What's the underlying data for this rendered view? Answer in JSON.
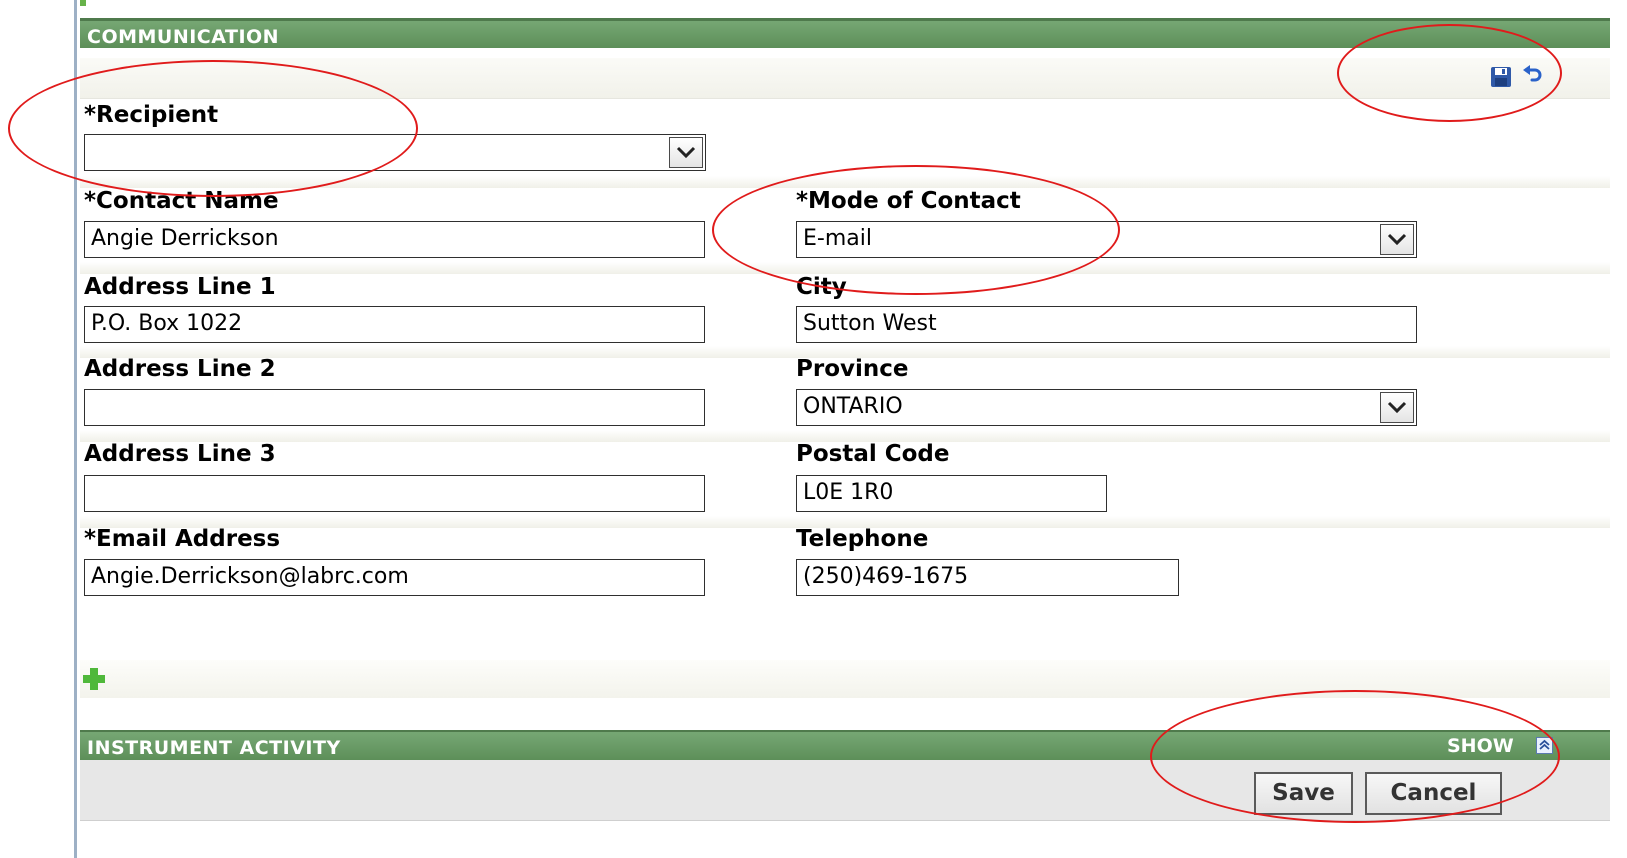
{
  "communication": {
    "title": "COMMUNICATION",
    "toolbar_icons": [
      "save-icon",
      "undo-icon"
    ]
  },
  "form": {
    "recipient": {
      "label": "*Recipient",
      "value": ""
    },
    "contact_name": {
      "label": "*Contact Name",
      "value": "Angie Derrickson"
    },
    "mode_of_contact": {
      "label": "*Mode of Contact",
      "value": "E-mail"
    },
    "address_line_1": {
      "label": "Address Line 1",
      "value": "P.O. Box 1022"
    },
    "city": {
      "label": "City",
      "value": "Sutton West"
    },
    "address_line_2": {
      "label": "Address Line 2",
      "value": ""
    },
    "province": {
      "label": "Province",
      "value": "ONTARIO"
    },
    "address_line_3": {
      "label": "Address Line 3",
      "value": ""
    },
    "postal_code": {
      "label": "Postal Code",
      "value": "L0E 1R0"
    },
    "email_address": {
      "label": "*Email Address",
      "value": "Angie.Derrickson@labrc.com"
    },
    "telephone": {
      "label": "Telephone",
      "value": "(250)469-1675"
    }
  },
  "instrument_activity": {
    "title": "INSTRUMENT ACTIVITY",
    "toggle_label": "SHOW"
  },
  "buttons": {
    "save": "Save",
    "cancel": "Cancel"
  },
  "colors": {
    "section_header": "#6a9b66",
    "annotation": "#e01b1b",
    "add_icon": "#4fb83a",
    "save_icon": "#2f59a8"
  }
}
